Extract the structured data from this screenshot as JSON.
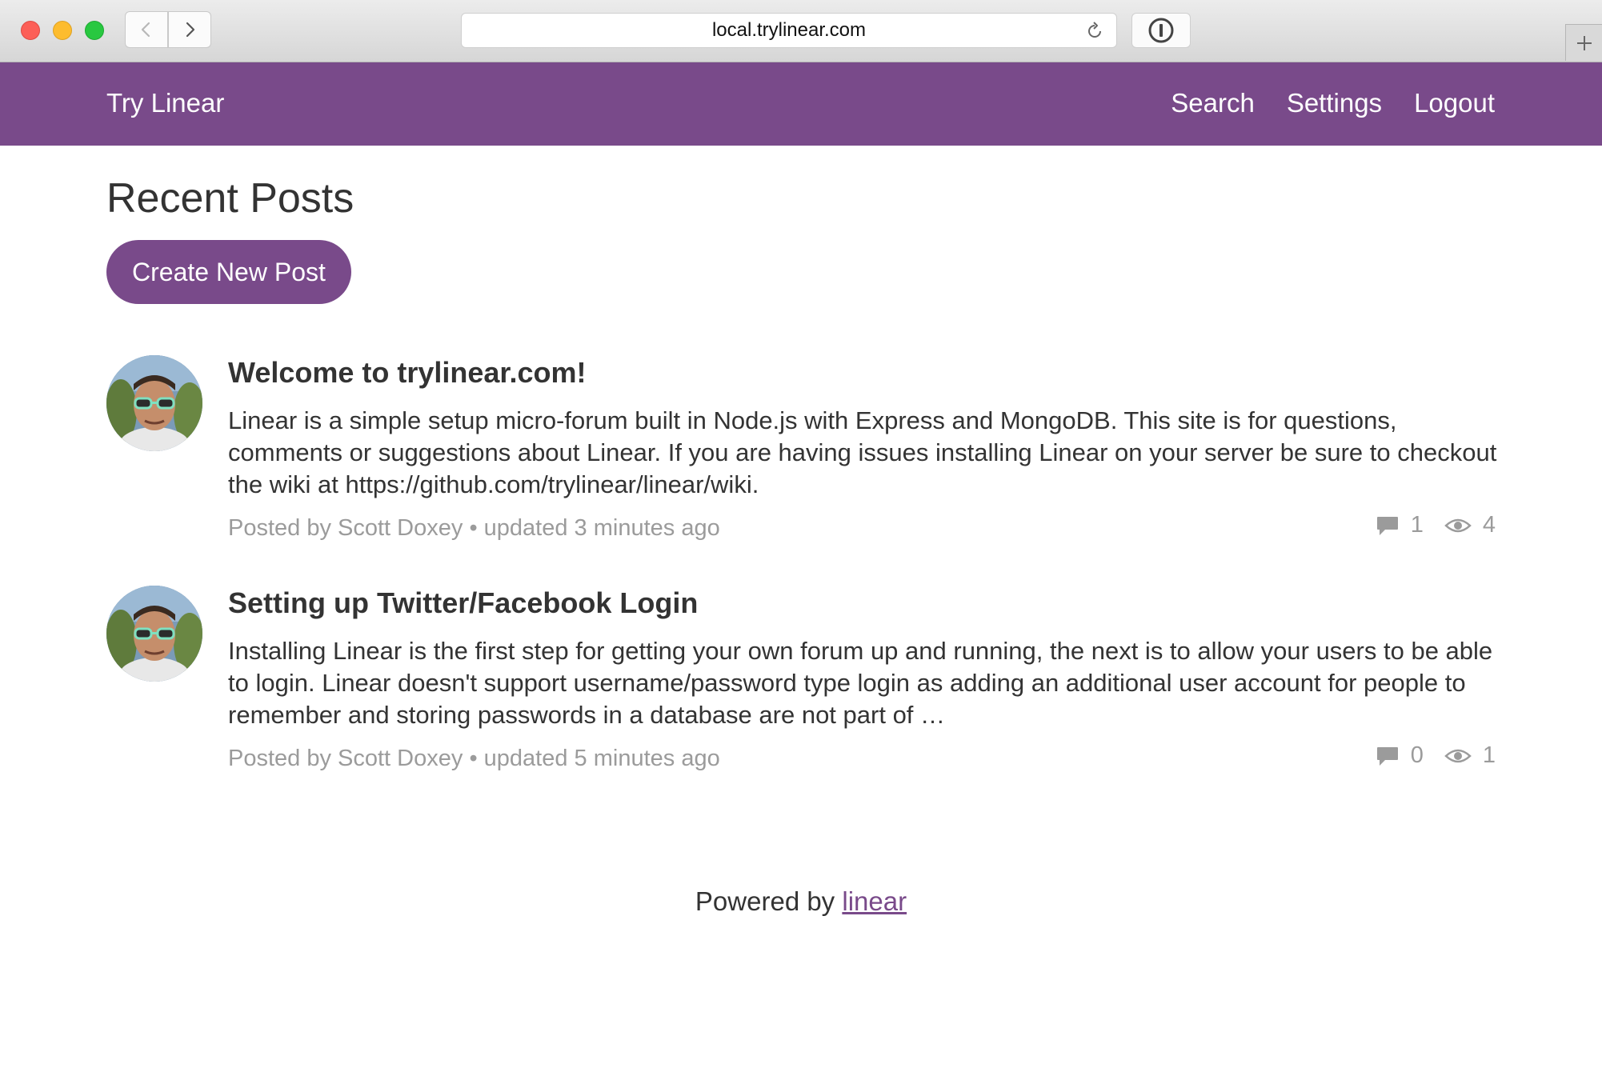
{
  "browser": {
    "url": "local.trylinear.com"
  },
  "navbar": {
    "brand": "Try Linear",
    "links": [
      "Search",
      "Settings",
      "Logout"
    ]
  },
  "main": {
    "title": "Recent Posts",
    "create_button": "Create New Post",
    "posts": [
      {
        "title": "Welcome to trylinear.com!",
        "body": "Linear is a simple setup micro-forum built in Node.js with Express and MongoDB. This site is for questions, comments or suggestions about Linear. If you are having issues installing Linear on your server be sure to checkout the wiki at https://github.com/trylinear/linear/wiki.",
        "posted_by": "Posted by Scott Doxey",
        "updated": "updated 3 minutes ago",
        "comments": "1",
        "views": "4"
      },
      {
        "title": "Setting up Twitter/Facebook Login",
        "body": "Installing Linear is the first step for getting your own forum up and running, the next is to allow your users to be able to login. Linear doesn't support username/password type login as adding an additional user account for people to remember and storing passwords in a database are not part of …",
        "posted_by": "Posted by Scott Doxey",
        "updated": "updated 5 minutes ago",
        "comments": "0",
        "views": "1"
      }
    ]
  },
  "footer": {
    "prefix": "Powered by",
    "link": "linear"
  },
  "colors": {
    "brand": "#794a8a",
    "muted": "#9b9b9b",
    "text": "#333333"
  },
  "icons": [
    "back-icon",
    "forward-icon",
    "reload-icon",
    "password-manager-icon",
    "new-tab-icon",
    "comment-icon",
    "eye-icon"
  ]
}
